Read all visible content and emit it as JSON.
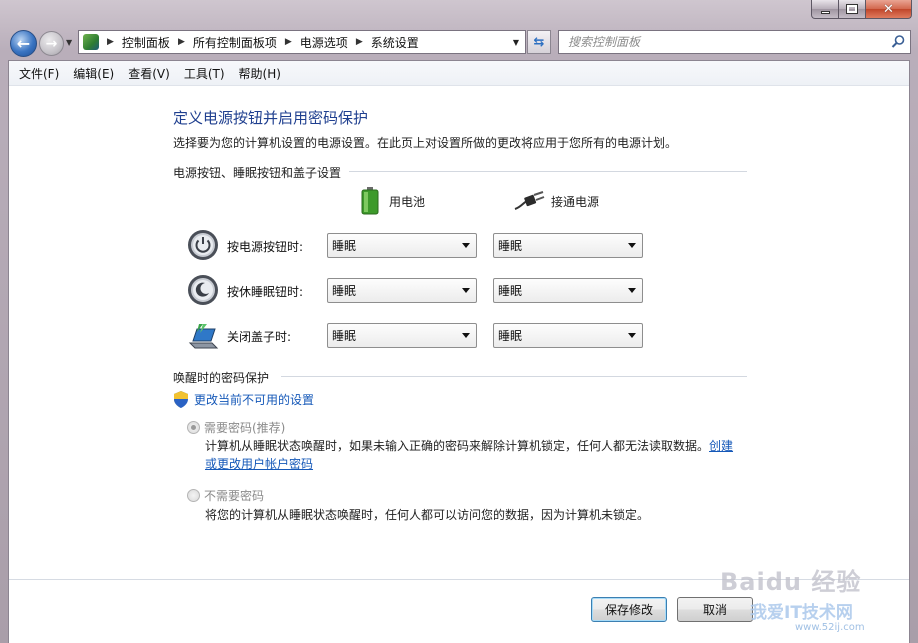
{
  "window": {
    "controls": {
      "minimize": "",
      "maximize": "",
      "close": "✕"
    }
  },
  "address_bar": {
    "breadcrumbs": [
      "控制面板",
      "所有控制面板项",
      "电源选项",
      "系统设置"
    ],
    "search_placeholder": "搜索控制面板"
  },
  "menu": {
    "items": [
      "文件(F)",
      "编辑(E)",
      "查看(V)",
      "工具(T)",
      "帮助(H)"
    ]
  },
  "page": {
    "title": "定义电源按钮并启用密码保护",
    "description": "选择要为您的计算机设置的电源设置。在此页上对设置所做的更改将应用于您所有的电源计划。"
  },
  "power_buttons": {
    "section_title": "电源按钮、睡眠按钮和盖子设置",
    "column_battery": "用电池",
    "column_plugged": "接通电源",
    "rows": [
      {
        "label": "按电源按钮时:",
        "battery": "睡眠",
        "plugged": "睡眠",
        "icon": "power-button-icon"
      },
      {
        "label": "按休睡眠钮时:",
        "battery": "睡眠",
        "plugged": "睡眠",
        "icon": "sleep-button-icon"
      },
      {
        "label": "关闭盖子时:",
        "battery": "睡眠",
        "plugged": "睡眠",
        "icon": "laptop-lid-icon"
      }
    ]
  },
  "password": {
    "section_title": "唤醒时的密码保护",
    "change_link": "更改当前不可用的设置",
    "require": {
      "label": "需要密码(推荐)",
      "desc_prefix": "计算机从睡眠状态唤醒时，如果未输入正确的密码来解除计算机锁定，任何人都无法读取数据。",
      "link": "创建或更改用户帐户密码",
      "checked": true
    },
    "no_require": {
      "label": "不需要密码",
      "desc": "将您的计算机从睡眠状态唤醒时，任何人都可以访问您的数据，因为计算机未锁定。",
      "checked": false
    }
  },
  "footer": {
    "save_label": "保存修改",
    "cancel_label": "取消"
  },
  "watermark": {
    "line1": "Baidu 经验",
    "line2": "我爱IT技术网",
    "line3": "www.52ij.com"
  },
  "colors": {
    "title_blue": "#1f3f8f",
    "link_blue": "#1558b8",
    "frame": "#b9aeba"
  }
}
